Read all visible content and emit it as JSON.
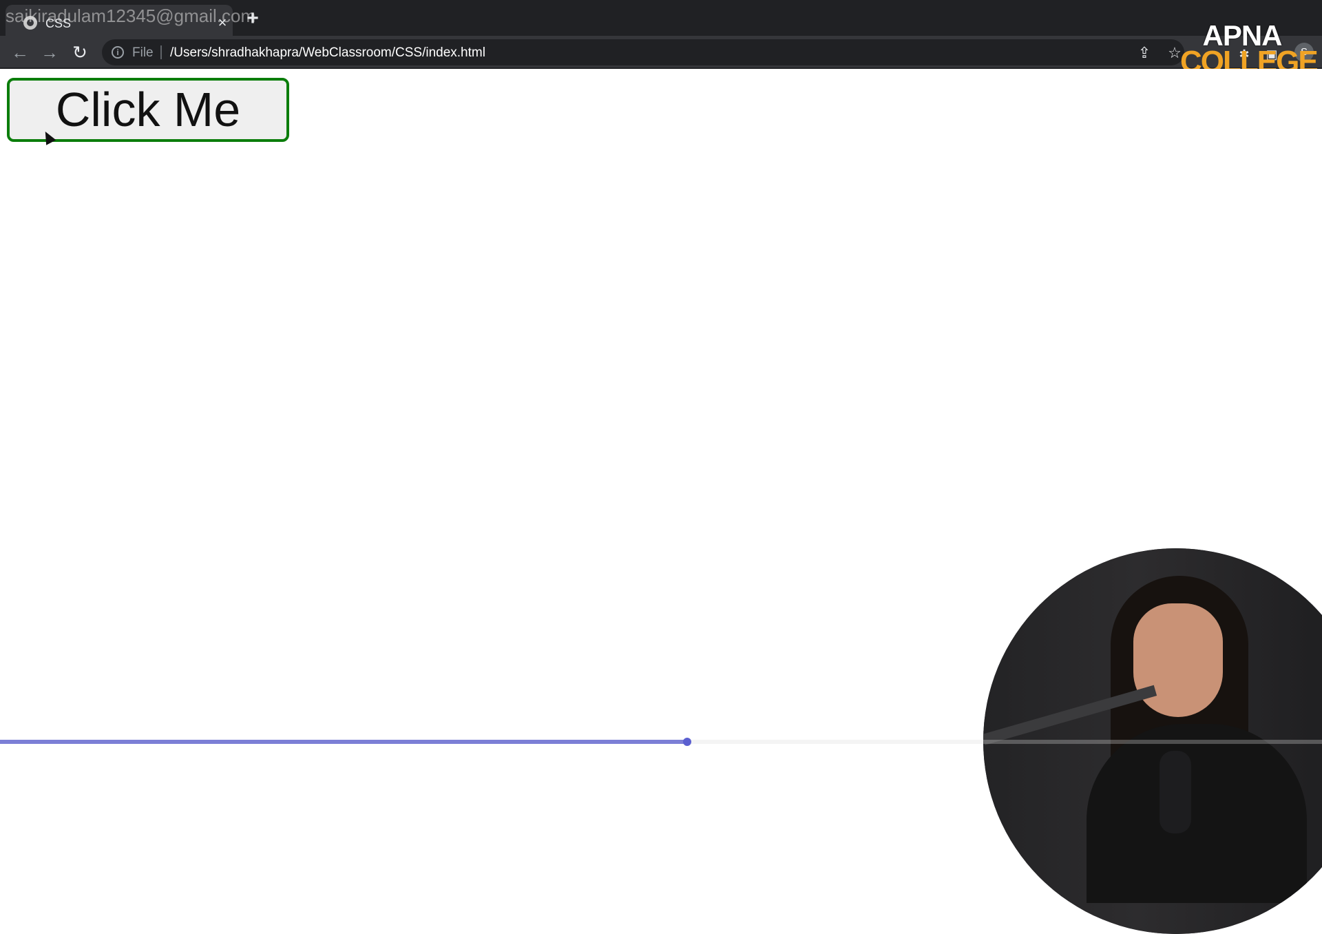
{
  "browser": {
    "tab": {
      "title": "CSS",
      "close_glyph": "×",
      "favicon": "globe-icon"
    },
    "new_tab_glyph": "+",
    "overlay_email": "saikiradulam12345@gmail.com",
    "toolbar": {
      "back_glyph": "←",
      "forward_glyph": "→",
      "reload_glyph": "↻",
      "info_glyph": "i",
      "scheme_label": "File",
      "url": "/Users/shradhakhapra/WebClassroom/CSS/index.html",
      "share_glyph": "⇪",
      "star_glyph": "☆",
      "profile_initial": "S"
    }
  },
  "brand": {
    "line1": "APNA",
    "line2": "COLLEGE",
    "colors": {
      "primary": "#ffffff",
      "accent": "#f0a324"
    }
  },
  "page": {
    "button": {
      "label": "Click Me",
      "border_color": "#0b7d0b",
      "background": "#efefef"
    }
  },
  "video": {
    "progress_fraction": 0.52,
    "progress_color": "#7c7fd6"
  }
}
